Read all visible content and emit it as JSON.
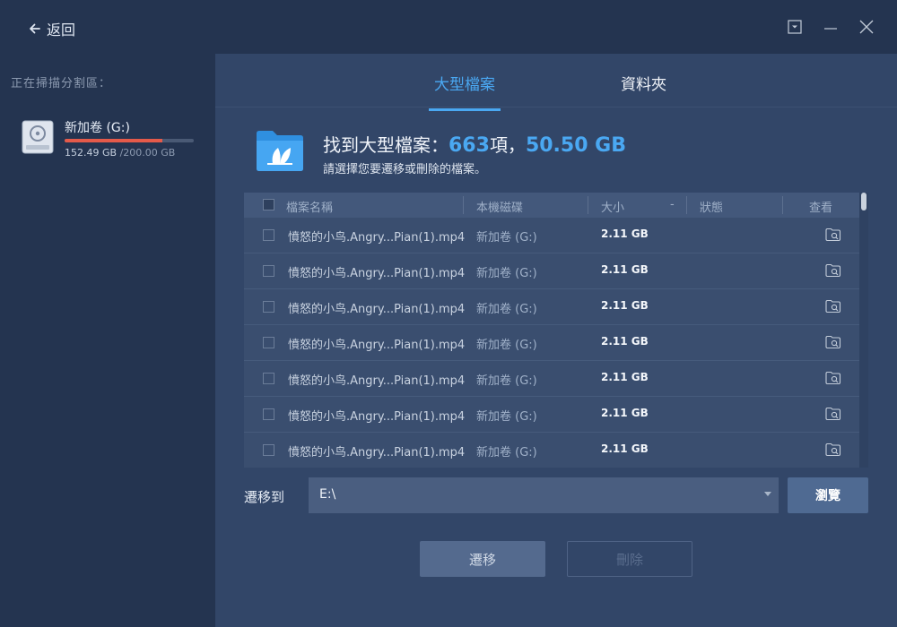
{
  "window": {
    "back_label": "返回",
    "controls": [
      "dropdown-icon",
      "minimize-icon",
      "close-icon"
    ]
  },
  "sidebar": {
    "scan_label": "正在掃描分割區：",
    "drive": {
      "name": "新加卷 (G:)",
      "used": "152.49 GB",
      "total": "/200.00 GB",
      "usage_fraction": 0.76,
      "usage_color": "#e45a4a"
    }
  },
  "tabs": [
    {
      "label": "大型檔案",
      "active": true
    },
    {
      "label": "資料夾",
      "active": false
    }
  ],
  "summary": {
    "prefix": "找到大型檔案：",
    "count": "663",
    "count_unit": "項，",
    "size": "50.50 GB",
    "subtitle": "請選擇您要遷移或刪除的檔案。"
  },
  "table": {
    "columns": {
      "name": "檔案名稱",
      "disk": "本機磁碟",
      "size": "大小",
      "sort": "-",
      "status": "狀態",
      "view": "查看"
    },
    "rows": [
      {
        "name": "憤怒的小鸟.Angry...Pian(1).mp4",
        "disk": "新加卷 (G:)",
        "size": "2.11 GB",
        "status": ""
      },
      {
        "name": "憤怒的小鸟.Angry...Pian(1).mp4",
        "disk": "新加卷 (G:)",
        "size": "2.11 GB",
        "status": ""
      },
      {
        "name": "憤怒的小鸟.Angry...Pian(1).mp4",
        "disk": "新加卷 (G:)",
        "size": "2.11 GB",
        "status": ""
      },
      {
        "name": "憤怒的小鸟.Angry...Pian(1).mp4",
        "disk": "新加卷 (G:)",
        "size": "2.11 GB",
        "status": ""
      },
      {
        "name": "憤怒的小鸟.Angry...Pian(1).mp4",
        "disk": "新加卷 (G:)",
        "size": "2.11 GB",
        "status": ""
      },
      {
        "name": "憤怒的小鸟.Angry...Pian(1).mp4",
        "disk": "新加卷 (G:)",
        "size": "2.11 GB",
        "status": ""
      },
      {
        "name": "憤怒的小鸟.Angry...Pian(1).mp4",
        "disk": "新加卷 (G:)",
        "size": "2.11 GB",
        "status": ""
      }
    ]
  },
  "move": {
    "label": "遷移到",
    "path": "E:\\",
    "browse_label": "瀏覽"
  },
  "actions": {
    "move_label": "遷移",
    "delete_label": "刪除"
  },
  "colors": {
    "accent": "#4aa8f2",
    "background": "#243450",
    "panel": "#324668"
  }
}
